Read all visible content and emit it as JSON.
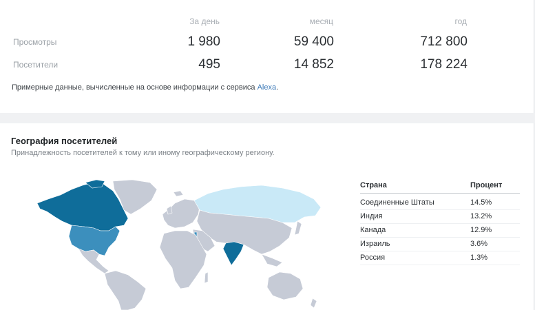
{
  "stats": {
    "columns": [
      "За день",
      "месяц",
      "год"
    ],
    "rows": [
      {
        "label": "Просмотры",
        "values": [
          "1 980",
          "59 400",
          "712 800"
        ]
      },
      {
        "label": "Посетители",
        "values": [
          "495",
          "14 852",
          "178 224"
        ]
      }
    ],
    "note_prefix": "Примерные данные, вычисленные на основе информации с сервиса ",
    "note_link": "Alexa",
    "note_suffix": "."
  },
  "geo": {
    "title": "География посетителей",
    "subtitle": "Принадлежность посетителей к тому или иному географическому региону.",
    "table_headers": [
      "Страна",
      "Процент"
    ],
    "countries": [
      {
        "name": "Соединенные Штаты",
        "percent": "14.5%"
      },
      {
        "name": "Индия",
        "percent": "13.2%"
      },
      {
        "name": "Канада",
        "percent": "12.9%"
      },
      {
        "name": "Израиль",
        "percent": "3.6%"
      },
      {
        "name": "Россия",
        "percent": "1.3%"
      }
    ],
    "colors": {
      "dark": "#0f6d9a",
      "medium": "#3c8fbd",
      "light": "#c9e9f7",
      "default": "#c6cbd6"
    }
  }
}
